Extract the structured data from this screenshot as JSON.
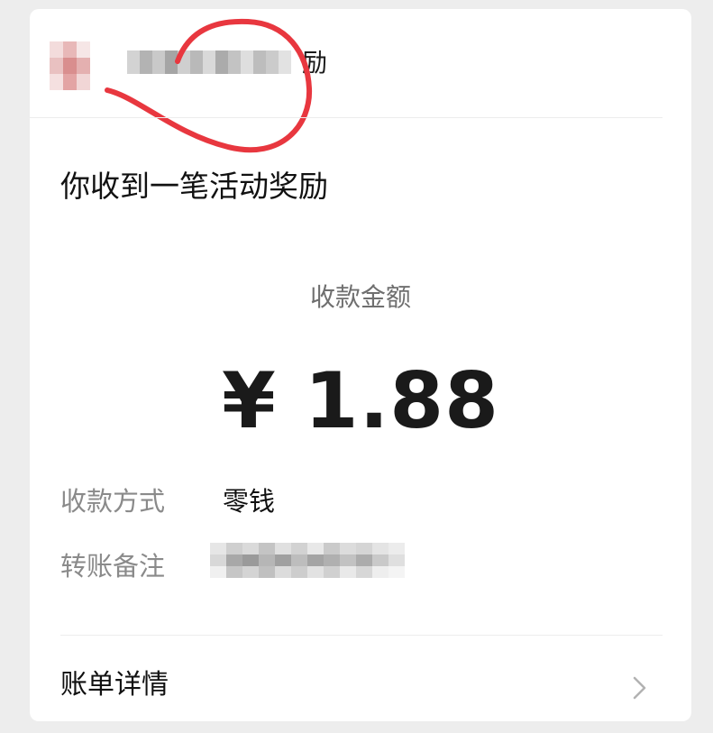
{
  "header": {
    "sender_name_tail": "励",
    "sender_name_obscured": true,
    "avatar_obscured": true
  },
  "title": "你收到一笔活动奖励",
  "amount": {
    "label": "收款金额",
    "value": "¥ 1.88"
  },
  "details": [
    {
      "label": "收款方式",
      "value": "零钱"
    },
    {
      "label": "转账备注",
      "value": ""
    }
  ],
  "bill_details": {
    "label": "账单详情"
  },
  "colors": {
    "annotation": "#e8373f",
    "background": "#ededed",
    "card": "#ffffff"
  },
  "icons": {
    "chevron": "chevron-right-icon"
  }
}
